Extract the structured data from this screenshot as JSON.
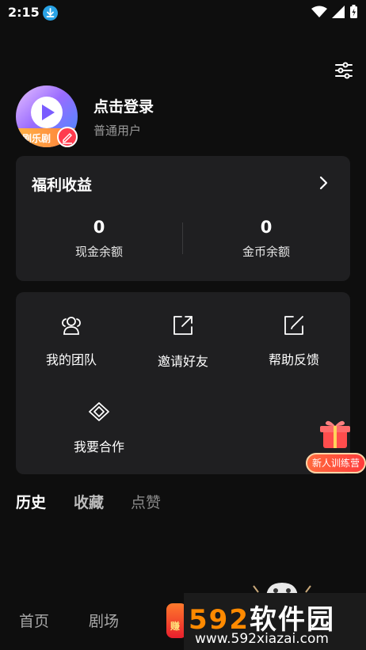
{
  "status_bar": {
    "time": "2:15",
    "download_icon": "download-icon",
    "wifi_icon": "wifi-icon",
    "signal_icon": "signal-icon",
    "battery_icon": "battery-charging-icon"
  },
  "toolbar": {
    "filter_icon": "sliders-icon"
  },
  "profile": {
    "avatar_text": "剧乐剧",
    "login_prompt": "点击登录",
    "user_type": "普通用户",
    "edit_icon": "pencil-icon"
  },
  "welfare": {
    "title": "福利收益",
    "stats": [
      {
        "value": "0",
        "label": "现金余额"
      },
      {
        "value": "0",
        "label": "金币余额"
      }
    ]
  },
  "menu": {
    "items": [
      {
        "label": "我的团队",
        "icon": "team-icon"
      },
      {
        "label": "邀请好友",
        "icon": "share-icon"
      },
      {
        "label": "帮助反馈",
        "icon": "edit-icon"
      },
      {
        "label": "我要合作",
        "icon": "handshake-icon"
      }
    ]
  },
  "floating_promo": {
    "label": "新人训练营"
  },
  "tabs": [
    {
      "label": "历史",
      "active": true
    },
    {
      "label": "收藏",
      "active": false
    },
    {
      "label": "点赞",
      "active": false
    }
  ],
  "bottom_nav": {
    "items": [
      {
        "label": "首页"
      },
      {
        "label": "剧场"
      }
    ],
    "earn_label": "赚"
  },
  "watermark": {
    "logo_number": "592",
    "logo_text": "软件园",
    "url": "www.592xiazai.com"
  },
  "colors": {
    "background": "#0e0e0e",
    "card": "#1f1f21",
    "accent_red": "#ff3b4e",
    "watermark_orange": "#ff8a00"
  }
}
